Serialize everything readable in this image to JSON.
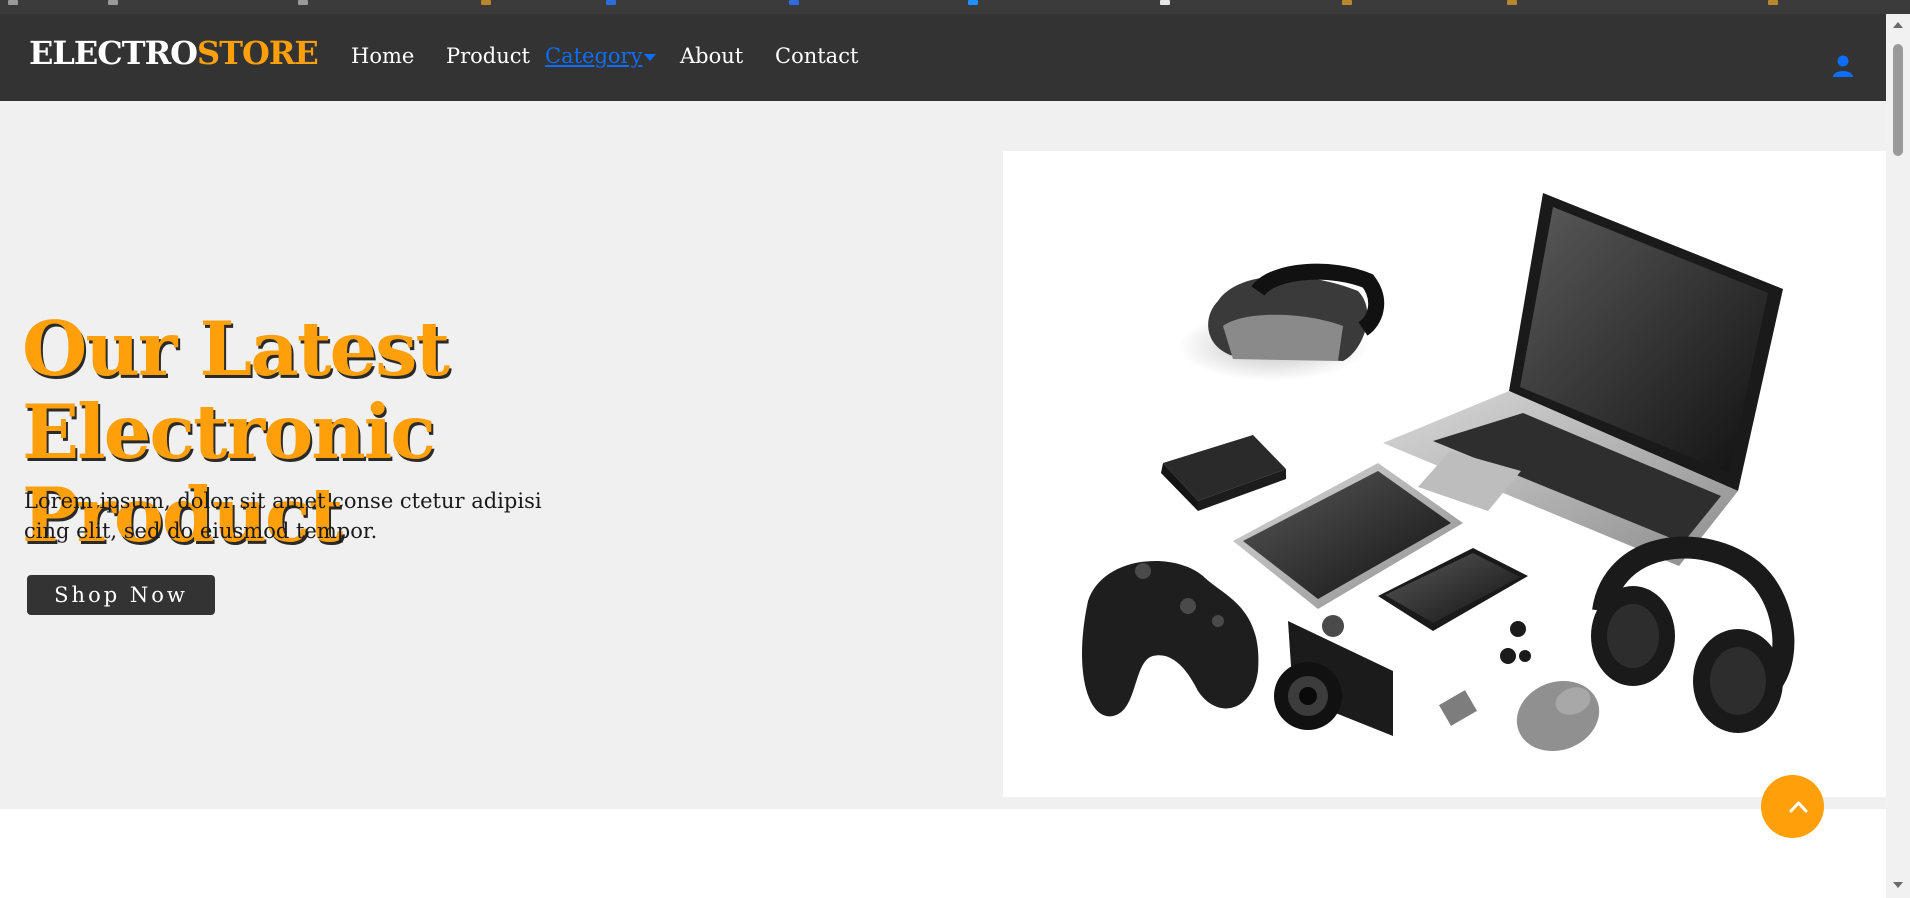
{
  "brand": {
    "part1": "ELECTRO",
    "part2": "STORE",
    "colors": {
      "primary": "#ff9f0a",
      "dark": "#333333",
      "link": "#0d6efd"
    }
  },
  "nav": {
    "items": [
      {
        "label": "Home",
        "active": false
      },
      {
        "label": "Product",
        "active": false
      },
      {
        "label": "Category ",
        "active": true,
        "has_dropdown": true
      },
      {
        "label": "About",
        "active": false
      },
      {
        "label": "Contact",
        "active": false
      }
    ],
    "user_icon": "user-icon"
  },
  "hero": {
    "title_line1": "Our Latest",
    "title_line2": "Electronic Product",
    "description": "Lorem ipsum, dolor sit amet conse ctetur adipisi cing elit, sed do eiusmod tempor.",
    "button_label": "Shop Now"
  },
  "scroll_top_icon": "chevron-up-icon"
}
